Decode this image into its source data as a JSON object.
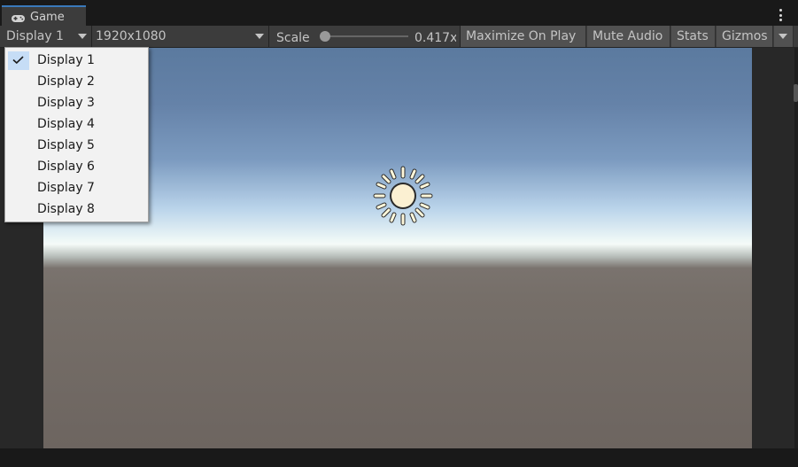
{
  "window": {
    "tab_title": "Game",
    "tab_icon": "gamepad-icon",
    "menu_icon": "vertical-dots-icon",
    "accent_color": "#3a79bb"
  },
  "toolbar": {
    "display_selected": "Display 1",
    "resolution": "1920x1080",
    "scale_label": "Scale",
    "scale_value": "0.417x",
    "scale_fraction": 0.0,
    "maximize_label": "Maximize On Play",
    "mute_label": "Mute Audio",
    "stats_label": "Stats",
    "gizmos_label": "Gizmos"
  },
  "display_menu": {
    "items": [
      {
        "label": "Display 1",
        "checked": true
      },
      {
        "label": "Display 2",
        "checked": false
      },
      {
        "label": "Display 3",
        "checked": false
      },
      {
        "label": "Display 4",
        "checked": false
      },
      {
        "label": "Display 5",
        "checked": false
      },
      {
        "label": "Display 6",
        "checked": false
      },
      {
        "label": "Display 7",
        "checked": false
      },
      {
        "label": "Display 8",
        "checked": false
      }
    ]
  },
  "viewport": {
    "icon": "directional-light-sun-icon",
    "sky_color": "#5b7a9f",
    "horizon_color": "#f5fbf8",
    "ground_color": "#6d6560"
  }
}
